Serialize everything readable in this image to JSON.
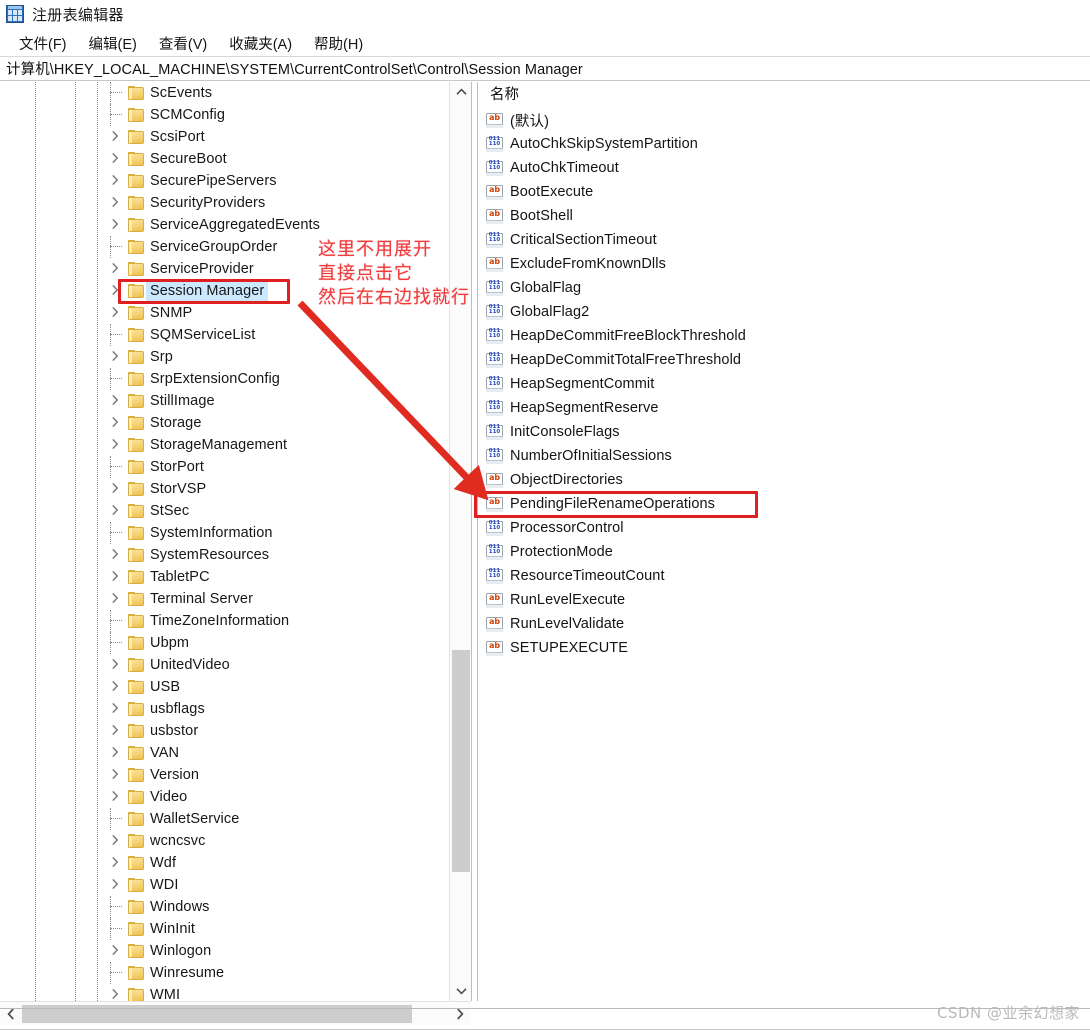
{
  "window": {
    "title": "注册表编辑器",
    "icon": "registry-editor-icon"
  },
  "menu": {
    "items": [
      {
        "label": "文件(F)",
        "name": "menu-file"
      },
      {
        "label": "编辑(E)",
        "name": "menu-edit"
      },
      {
        "label": "查看(V)",
        "name": "menu-view"
      },
      {
        "label": "收藏夹(A)",
        "name": "menu-favorites"
      },
      {
        "label": "帮助(H)",
        "name": "menu-help"
      }
    ]
  },
  "address": {
    "path": "计算机\\HKEY_LOCAL_MACHINE\\SYSTEM\\CurrentControlSet\\Control\\Session Manager"
  },
  "tree": {
    "items": [
      {
        "label": "ScEvents",
        "expandable": false,
        "selected": false
      },
      {
        "label": "SCMConfig",
        "expandable": false,
        "selected": false
      },
      {
        "label": "ScsiPort",
        "expandable": true,
        "selected": false
      },
      {
        "label": "SecureBoot",
        "expandable": true,
        "selected": false
      },
      {
        "label": "SecurePipeServers",
        "expandable": true,
        "selected": false
      },
      {
        "label": "SecurityProviders",
        "expandable": true,
        "selected": false
      },
      {
        "label": "ServiceAggregatedEvents",
        "expandable": true,
        "selected": false
      },
      {
        "label": "ServiceGroupOrder",
        "expandable": false,
        "selected": false
      },
      {
        "label": "ServiceProvider",
        "expandable": true,
        "selected": false
      },
      {
        "label": "Session Manager",
        "expandable": true,
        "selected": true
      },
      {
        "label": "SNMP",
        "expandable": true,
        "selected": false
      },
      {
        "label": "SQMServiceList",
        "expandable": false,
        "selected": false
      },
      {
        "label": "Srp",
        "expandable": true,
        "selected": false
      },
      {
        "label": "SrpExtensionConfig",
        "expandable": false,
        "selected": false
      },
      {
        "label": "StillImage",
        "expandable": true,
        "selected": false
      },
      {
        "label": "Storage",
        "expandable": true,
        "selected": false
      },
      {
        "label": "StorageManagement",
        "expandable": true,
        "selected": false
      },
      {
        "label": "StorPort",
        "expandable": false,
        "selected": false
      },
      {
        "label": "StorVSP",
        "expandable": true,
        "selected": false
      },
      {
        "label": "StSec",
        "expandable": true,
        "selected": false
      },
      {
        "label": "SystemInformation",
        "expandable": false,
        "selected": false
      },
      {
        "label": "SystemResources",
        "expandable": true,
        "selected": false
      },
      {
        "label": "TabletPC",
        "expandable": true,
        "selected": false
      },
      {
        "label": "Terminal Server",
        "expandable": true,
        "selected": false
      },
      {
        "label": "TimeZoneInformation",
        "expandable": false,
        "selected": false
      },
      {
        "label": "Ubpm",
        "expandable": false,
        "selected": false
      },
      {
        "label": "UnitedVideo",
        "expandable": true,
        "selected": false
      },
      {
        "label": "USB",
        "expandable": true,
        "selected": false
      },
      {
        "label": "usbflags",
        "expandable": true,
        "selected": false
      },
      {
        "label": "usbstor",
        "expandable": true,
        "selected": false
      },
      {
        "label": "VAN",
        "expandable": true,
        "selected": false
      },
      {
        "label": "Version",
        "expandable": true,
        "selected": false
      },
      {
        "label": "Video",
        "expandable": true,
        "selected": false
      },
      {
        "label": "WalletService",
        "expandable": false,
        "selected": false
      },
      {
        "label": "wcncsvc",
        "expandable": true,
        "selected": false
      },
      {
        "label": "Wdf",
        "expandable": true,
        "selected": false
      },
      {
        "label": "WDI",
        "expandable": true,
        "selected": false
      },
      {
        "label": "Windows",
        "expandable": false,
        "selected": false
      },
      {
        "label": "WinInit",
        "expandable": false,
        "selected": false
      },
      {
        "label": "Winlogon",
        "expandable": true,
        "selected": false
      },
      {
        "label": "Winresume",
        "expandable": false,
        "selected": false
      },
      {
        "label": "WMI",
        "expandable": true,
        "selected": false
      }
    ]
  },
  "values": {
    "header": "名称",
    "rows": [
      {
        "name": "(默认)",
        "type": "sz",
        "highlighted": false
      },
      {
        "name": "AutoChkSkipSystemPartition",
        "type": "dword",
        "highlighted": false
      },
      {
        "name": "AutoChkTimeout",
        "type": "dword",
        "highlighted": false
      },
      {
        "name": "BootExecute",
        "type": "sz",
        "highlighted": false
      },
      {
        "name": "BootShell",
        "type": "sz",
        "highlighted": false
      },
      {
        "name": "CriticalSectionTimeout",
        "type": "dword",
        "highlighted": false
      },
      {
        "name": "ExcludeFromKnownDlls",
        "type": "sz",
        "highlighted": false
      },
      {
        "name": "GlobalFlag",
        "type": "dword",
        "highlighted": false
      },
      {
        "name": "GlobalFlag2",
        "type": "dword",
        "highlighted": false
      },
      {
        "name": "HeapDeCommitFreeBlockThreshold",
        "type": "dword",
        "highlighted": false
      },
      {
        "name": "HeapDeCommitTotalFreeThreshold",
        "type": "dword",
        "highlighted": false
      },
      {
        "name": "HeapSegmentCommit",
        "type": "dword",
        "highlighted": false
      },
      {
        "name": "HeapSegmentReserve",
        "type": "dword",
        "highlighted": false
      },
      {
        "name": "InitConsoleFlags",
        "type": "dword",
        "highlighted": false
      },
      {
        "name": "NumberOfInitialSessions",
        "type": "dword",
        "highlighted": false
      },
      {
        "name": "ObjectDirectories",
        "type": "sz",
        "highlighted": false
      },
      {
        "name": "PendingFileRenameOperations",
        "type": "sz",
        "highlighted": true
      },
      {
        "name": "ProcessorControl",
        "type": "dword",
        "highlighted": false
      },
      {
        "name": "ProtectionMode",
        "type": "dword",
        "highlighted": false
      },
      {
        "name": "ResourceTimeoutCount",
        "type": "dword",
        "highlighted": false
      },
      {
        "name": "RunLevelExecute",
        "type": "sz",
        "highlighted": false
      },
      {
        "name": "RunLevelValidate",
        "type": "sz",
        "highlighted": false
      },
      {
        "name": "SETUPEXECUTE",
        "type": "sz",
        "highlighted": false
      }
    ],
    "icon_glyphs": {
      "sz": "ab",
      "dword_top": "011",
      "dword_bottom": "110"
    }
  },
  "annotation": {
    "line1": "这里不用展开",
    "line2": "直接点击它",
    "line3": "然后在右边找就行",
    "color": "#ef3b3b"
  },
  "highlight": {
    "color": "#e02020"
  },
  "watermark": {
    "text": "CSDN @业余幻想家"
  },
  "scrollbars": {
    "tree_vertical": {
      "up": "▲",
      "down": "▼"
    },
    "tree_horizontal": {
      "left": "‹",
      "right": "›"
    }
  }
}
